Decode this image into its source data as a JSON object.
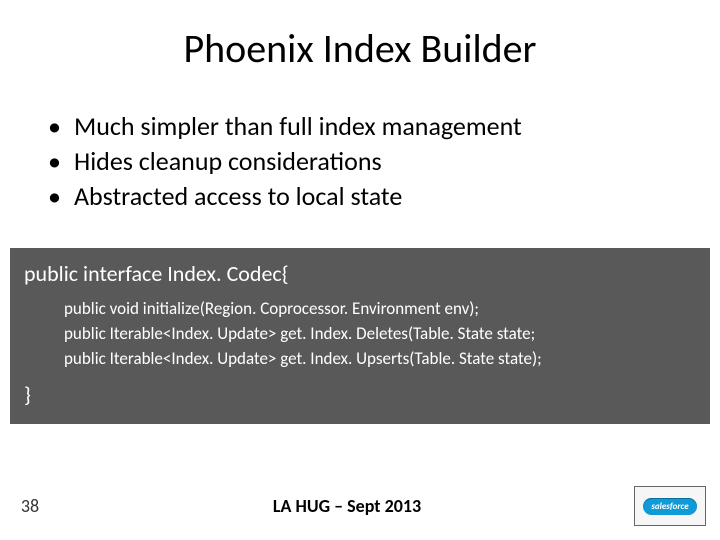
{
  "title": "Phoenix Index Builder",
  "bullets": [
    "Much simpler than full index management",
    "Hides cleanup considerations",
    "Abstracted access to local state"
  ],
  "code": {
    "head": "public interface Index. Codec{",
    "lines": [
      "public void initialize(Region. Coprocessor. Environment env);",
      "public Iterable<Index. Update> get. Index. Deletes(Table. State state;",
      "public Iterable<Index. Update> get. Index. Upserts(Table. State state);"
    ],
    "tail": "}"
  },
  "footer": {
    "page": "38",
    "conference": "LA HUG – Sept 2013",
    "logo_text": "salesforce"
  }
}
